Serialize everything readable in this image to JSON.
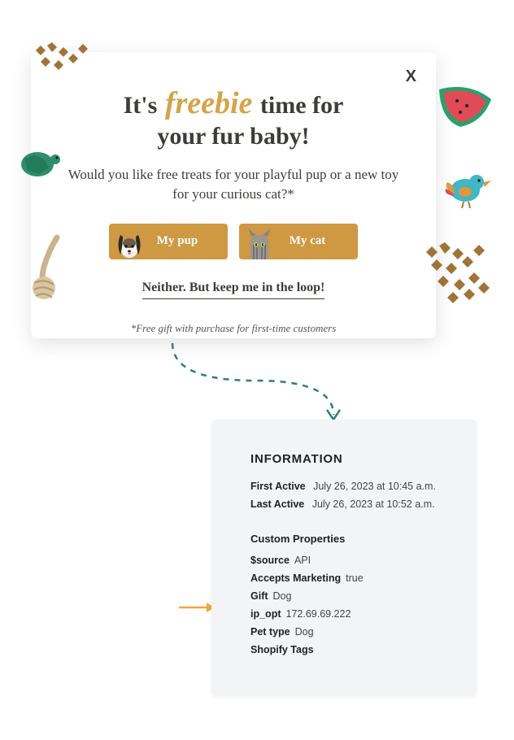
{
  "popup": {
    "close_glyph": "X",
    "headline_pre": "It's",
    "headline_accent": "freebie",
    "headline_mid": "time for",
    "headline_line2": "your fur baby!",
    "subhead": "Would you like free treats for your playful pup or a new toy for your curious cat?*",
    "choices": {
      "pup_label": "My pup",
      "cat_label": "My cat"
    },
    "neither_link": "Neither. But keep me in the loop!",
    "disclaimer": "*Free gift with purchase for first-time customers",
    "accent_color": "#d4a34a",
    "button_color": "#cf9842",
    "icons": {
      "treats_tl": "treats",
      "watermelon": "watermelon-toy",
      "turtle": "turtle-toy",
      "bird": "bird-toy",
      "rope": "rope-toy",
      "treats_br": "treats"
    }
  },
  "info": {
    "title": "INFORMATION",
    "first_active_label": "First Active",
    "first_active_value": "July 26, 2023 at 10:45 a.m.",
    "last_active_label": "Last Active",
    "last_active_value": "July 26, 2023 at 10:52 a.m.",
    "custom_properties_heading": "Custom Properties",
    "properties": [
      {
        "key": "$source",
        "value": "API"
      },
      {
        "key": "Accepts Marketing",
        "value": "true"
      },
      {
        "key": "Gift",
        "value": "Dog"
      },
      {
        "key": "ip_opt",
        "value": "172.69.69.222"
      },
      {
        "key": "Pet type",
        "value": "Dog"
      },
      {
        "key": "Shopify Tags",
        "value": ""
      }
    ]
  }
}
